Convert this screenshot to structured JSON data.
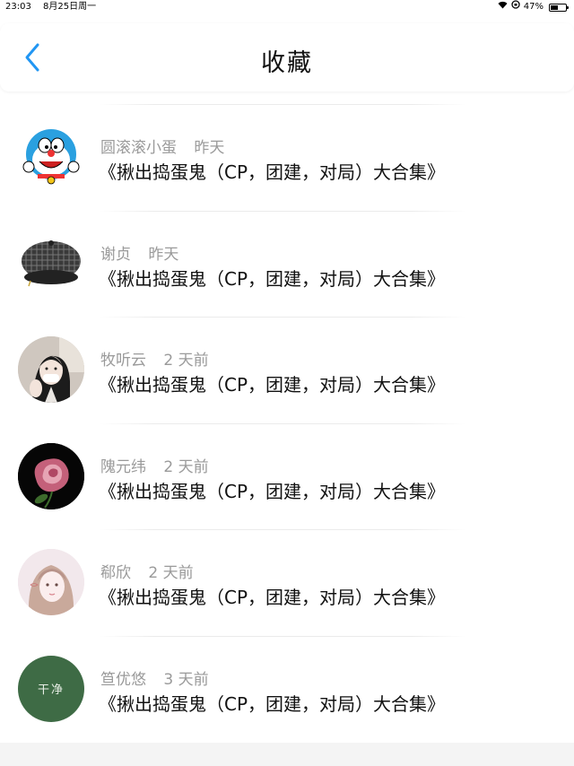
{
  "status": {
    "time": "23:03",
    "date": "8月25日周一",
    "battery_text": "47%",
    "battery_level": 0.47,
    "icons": [
      "wifi-icon",
      "rotation-lock-icon",
      "battery-icon"
    ]
  },
  "header": {
    "title": "收藏",
    "back_icon": "chevron-left-icon",
    "accent": "#2196f3"
  },
  "favorites": [
    {
      "name": "圆滚滚小蛋",
      "time": "昨天",
      "title": "《揪出捣蛋鬼（CP，团建，对局）大合集》",
      "avatar": "cartoon-robot-cat"
    },
    {
      "name": "谢贞",
      "time": "昨天",
      "title": "《揪出捣蛋鬼（CP，团建，对局）大合集》",
      "avatar": "plaid-cap"
    },
    {
      "name": "牧听云",
      "time": "2 天前",
      "title": "《揪出捣蛋鬼（CP，团建，对局）大合集》",
      "avatar": "girl-photo"
    },
    {
      "name": "隗元纬",
      "time": "2 天前",
      "title": "《揪出捣蛋鬼（CP，团建，对局）大合集》",
      "avatar": "rose"
    },
    {
      "name": "郗欣",
      "time": "2 天前",
      "title": "《揪出捣蛋鬼（CP，团建，对局）大合集》",
      "avatar": "pink-girl"
    },
    {
      "name": "笪优悠",
      "time": "3 天前",
      "title": "《揪出捣蛋鬼（CP，团建，对局）大合集》",
      "avatar": "green-text",
      "avatar_text": "干净"
    }
  ]
}
